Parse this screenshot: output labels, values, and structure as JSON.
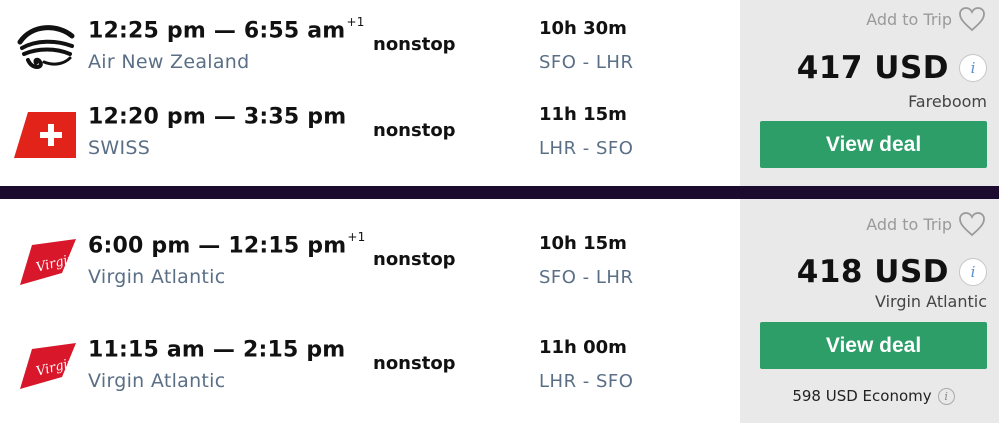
{
  "results": [
    {
      "legs": [
        {
          "times": "12:25 pm — 6:55 am",
          "day_offset": "+1",
          "airline": "Air New Zealand",
          "logo": "air-new-zealand-logo",
          "stops": "nonstop",
          "duration": "10h 30m",
          "route": "SFO - LHR"
        },
        {
          "times": "12:20 pm — 3:35 pm",
          "day_offset": "",
          "airline": "SWISS",
          "logo": "swiss-logo",
          "stops": "nonstop",
          "duration": "11h 15m",
          "route": "LHR - SFO"
        }
      ],
      "add_to_trip": "Add to Trip",
      "price": "417 USD",
      "info_glyph": "i",
      "provider": "Fareboom",
      "deal_label": "View deal"
    },
    {
      "legs": [
        {
          "times": "6:00 pm — 12:15 pm",
          "day_offset": "+1",
          "airline": "Virgin Atlantic",
          "logo": "virgin-atlantic-logo",
          "stops": "nonstop",
          "duration": "10h 15m",
          "route": "SFO - LHR"
        },
        {
          "times": "11:15 am — 2:15 pm",
          "day_offset": "",
          "airline": "Virgin Atlantic",
          "logo": "virgin-atlantic-logo",
          "stops": "nonstop",
          "duration": "11h 00m",
          "route": "LHR - SFO"
        }
      ],
      "add_to_trip": "Add to Trip",
      "price": "418 USD",
      "info_glyph": "i",
      "provider": "Virgin Atlantic",
      "deal_label": "View deal",
      "alt_price": "598 USD Economy"
    }
  ],
  "logo_texts": {
    "virgin": "Virgin"
  },
  "colors": {
    "deal_button": "#2e9e69",
    "divider": "#1c0b2e",
    "sidebar": "#e9e9ea",
    "secondary_text": "#5a6f86",
    "swiss_red": "#e2231a",
    "virgin_red": "#d8172b"
  }
}
